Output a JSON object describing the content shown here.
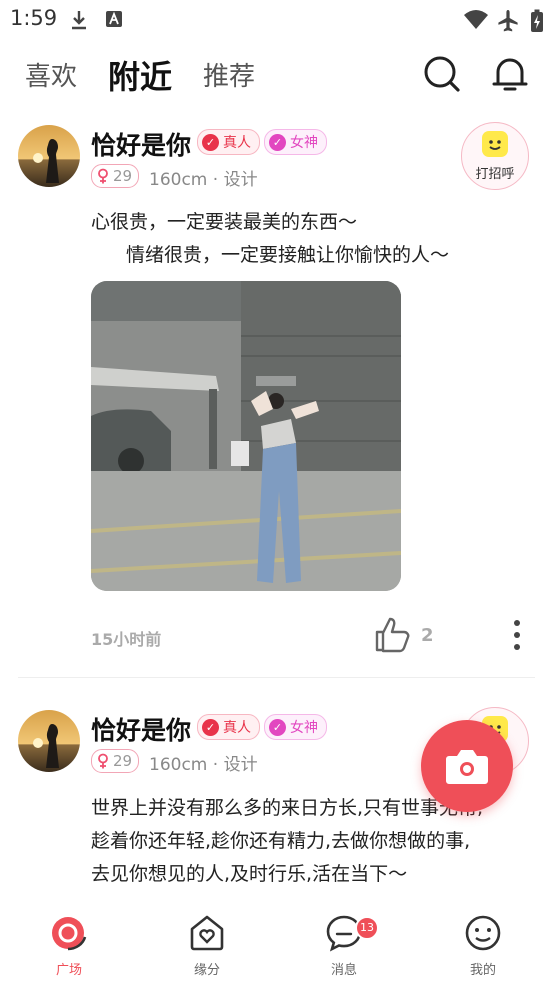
{
  "status_bar": {
    "time": "1:59"
  },
  "top_nav": {
    "tabs": [
      {
        "label": "喜欢"
      },
      {
        "label": "附近"
      },
      {
        "label": "推荐"
      }
    ]
  },
  "posts": [
    {
      "username": "恰好是你",
      "badges": {
        "real": "真人",
        "goddess": "女神"
      },
      "age": "29",
      "meta": "160cm · 设计",
      "greet_label": "打招呼",
      "content": [
        "心很贵，一定要装最美的东西～",
        "情绪很贵，一定要接触让你愉快的人～"
      ],
      "time": "15小时前",
      "like_count": "2"
    },
    {
      "username": "恰好是你",
      "badges": {
        "real": "真人",
        "goddess": "女神"
      },
      "age": "29",
      "meta": "160cm · 设计",
      "content": [
        "世界上并没有那么多的来日方长,只有世事无常,",
        "趁着你还年轻,趁你还有精力,去做你想做的事,",
        "去见你想见的人,及时行乐,活在当下～"
      ]
    }
  ],
  "bottom_tabs": [
    {
      "label": "广场"
    },
    {
      "label": "缘分"
    },
    {
      "label": "消息",
      "badge": "13"
    },
    {
      "label": "我的"
    }
  ],
  "colors": {
    "accent": "#ef4f58",
    "badge_real": "#e8334a",
    "badge_goddess": "#e247c0"
  }
}
